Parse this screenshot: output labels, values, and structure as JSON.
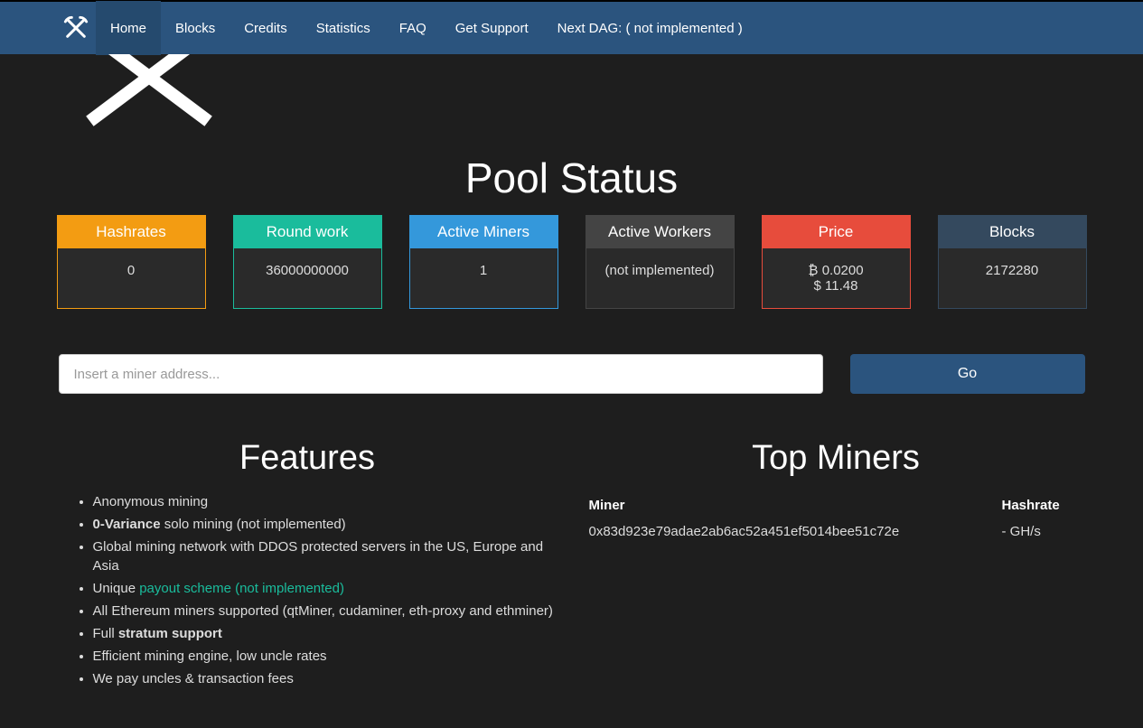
{
  "nav": {
    "items": [
      "Home",
      "Blocks",
      "Credits",
      "Statistics",
      "FAQ",
      "Get Support",
      "Next DAG: ( not implemented )"
    ],
    "active_index": 0
  },
  "pool_title": "Pool Status",
  "stats": {
    "hashrates": {
      "label": "Hashrates",
      "value": "0"
    },
    "round_work": {
      "label": "Round work",
      "value": "36000000000"
    },
    "active_miners": {
      "label": "Active Miners",
      "value": "1"
    },
    "active_workers": {
      "label": "Active Workers",
      "value": "(not implemented)"
    },
    "price": {
      "label": "Price",
      "btc": "₿ 0.0200",
      "usd": "$ 11.48"
    },
    "blocks": {
      "label": "Blocks",
      "value": "2172280"
    }
  },
  "search": {
    "placeholder": "Insert a miner address...",
    "go": "Go"
  },
  "features": {
    "title": "Features",
    "items": [
      {
        "text": "Anonymous mining"
      },
      {
        "prefix_bold": "0-Variance",
        "text": " solo mining (not implemented)"
      },
      {
        "text": "Global mining network with DDOS protected servers in the US, Europe and Asia"
      },
      {
        "prefix": "Unique ",
        "link": "payout scheme (not implemented)"
      },
      {
        "text": "All Ethereum miners supported (qtMiner, cudaminer, eth-proxy and ethminer)"
      },
      {
        "prefix": "Full ",
        "bold": "stratum support"
      },
      {
        "text": "Efficient mining engine, low uncle rates"
      },
      {
        "text": "We pay uncles & transaction fees"
      }
    ]
  },
  "top_miners": {
    "title": "Top Miners",
    "col_miner": "Miner",
    "col_hashrate": "Hashrate",
    "rows": [
      {
        "miner": "0x83d923e79adae2ab6ac52a451ef5014bee51c72e",
        "hashrate": "- GH/s"
      }
    ]
  }
}
